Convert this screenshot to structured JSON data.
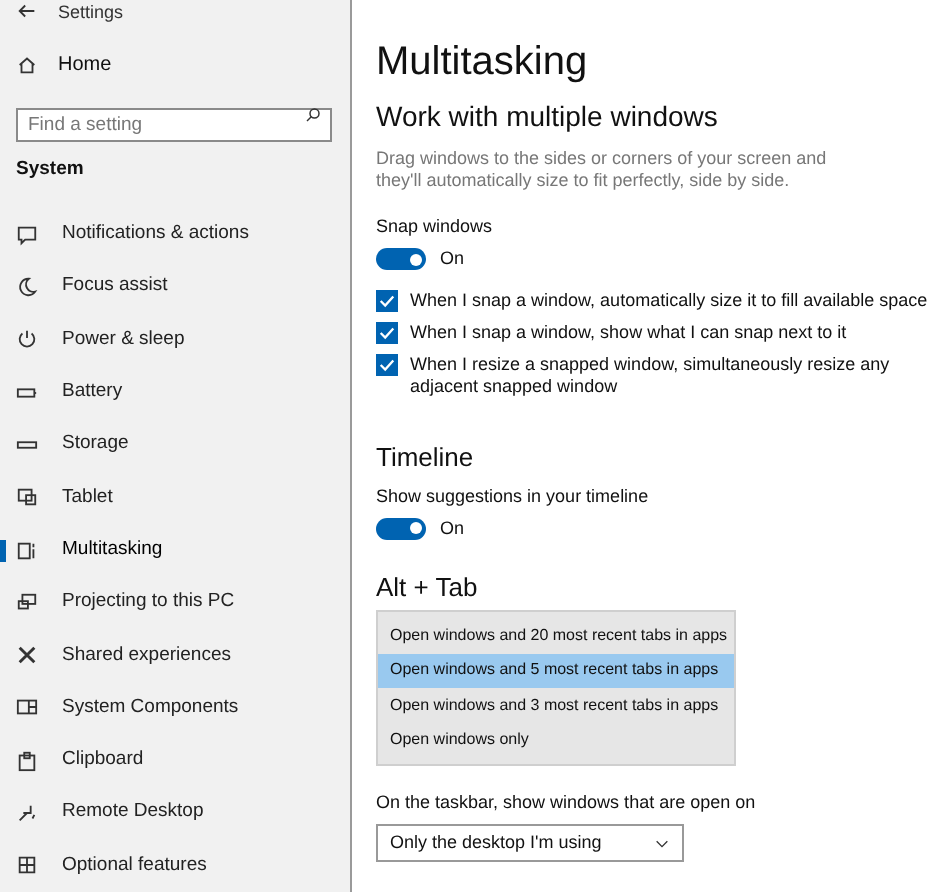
{
  "window": {
    "title": "Settings"
  },
  "sidebar": {
    "home": "Home",
    "search": {
      "placeholder": "Find a setting"
    },
    "section": "System",
    "items": [
      {
        "label": "Notifications & actions",
        "selected": false
      },
      {
        "label": "Focus assist",
        "selected": false
      },
      {
        "label": "Power & sleep",
        "selected": false
      },
      {
        "label": "Battery",
        "selected": false
      },
      {
        "label": "Storage",
        "selected": false
      },
      {
        "label": "Tablet",
        "selected": false
      },
      {
        "label": "Multitasking",
        "selected": true
      },
      {
        "label": "Projecting to this PC",
        "selected": false
      },
      {
        "label": "Shared experiences",
        "selected": false
      },
      {
        "label": "System Components",
        "selected": false
      },
      {
        "label": "Clipboard",
        "selected": false
      },
      {
        "label": "Remote Desktop",
        "selected": false
      },
      {
        "label": "Optional features",
        "selected": false
      }
    ]
  },
  "page": {
    "title": "Multitasking",
    "snap": {
      "heading": "Work with multiple windows",
      "description": "Drag windows to the sides or corners of your screen and they'll automatically size to fit perfectly, side by side.",
      "toggle": {
        "label": "Snap windows",
        "on": true,
        "state_text": "On"
      },
      "options": [
        {
          "label": "When I snap a window, automatically size it to fill available space",
          "checked": true
        },
        {
          "label": "When I snap a window, show what I can snap next to it",
          "checked": true
        },
        {
          "label": "When I resize a snapped window, simultaneously resize any adjacent snapped window",
          "checked": true
        }
      ]
    },
    "timeline": {
      "heading": "Timeline",
      "toggle": {
        "label": "Show suggestions in your timeline",
        "on": true,
        "state_text": "On"
      }
    },
    "alt_tab": {
      "heading": "Alt + Tab",
      "options": [
        {
          "label": "Open windows and 20 most recent tabs in apps",
          "selected": false
        },
        {
          "label": "Open windows and 5 most recent tabs in apps",
          "selected": true
        },
        {
          "label": "Open windows and 3 most recent tabs in apps",
          "selected": false
        },
        {
          "label": "Open windows only",
          "selected": false
        }
      ]
    },
    "taskbar": {
      "label": "On the taskbar, show windows that are open on",
      "value": "Only the desktop I'm using"
    }
  }
}
